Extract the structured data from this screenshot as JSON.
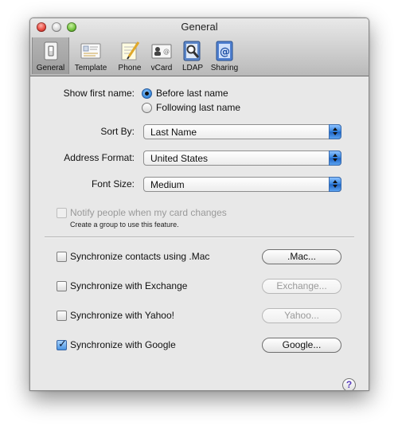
{
  "window": {
    "title": "General"
  },
  "toolbar": {
    "items": [
      {
        "label": "General",
        "icon": "light-switch-icon"
      },
      {
        "label": "Template",
        "icon": "template-card-icon"
      },
      {
        "label": "Phone",
        "icon": "phone-pencil-icon"
      },
      {
        "label": "vCard",
        "icon": "vcard-icon"
      },
      {
        "label": "LDAP",
        "icon": "ldap-magnifier-icon"
      },
      {
        "label": "Sharing",
        "icon": "sharing-at-icon"
      }
    ],
    "selected": "General"
  },
  "general": {
    "show_first_name_label": "Show first name:",
    "show_first_name_options": [
      "Before last name",
      "Following last name"
    ],
    "show_first_name_selected": "Before last name",
    "sort_by_label": "Sort By:",
    "sort_by_value": "Last Name",
    "address_format_label": "Address Format:",
    "address_format_value": "United States",
    "font_size_label": "Font Size:",
    "font_size_value": "Medium",
    "notify_label": "Notify people when my card changes",
    "notify_note": "Create a group to use this feature.",
    "notify_checked": false,
    "notify_enabled": false
  },
  "sync": [
    {
      "label": "Synchronize contacts using .Mac",
      "button": ".Mac...",
      "checked": false,
      "button_enabled": true
    },
    {
      "label": "Synchronize with Exchange",
      "button": "Exchange...",
      "checked": false,
      "button_enabled": false
    },
    {
      "label": "Synchronize with Yahoo!",
      "button": "Yahoo...",
      "checked": false,
      "button_enabled": false
    },
    {
      "label": "Synchronize with Google",
      "button": "Google...",
      "checked": true,
      "button_enabled": true
    }
  ],
  "help": {
    "glyph": "?"
  },
  "colors": {
    "accent": "#3d8fe0",
    "help": "#5a3fbf"
  }
}
